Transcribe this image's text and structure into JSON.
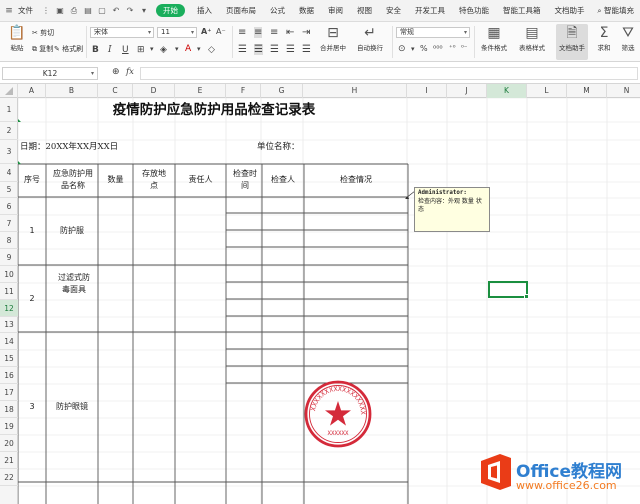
{
  "menubar": {
    "file_label": "文件",
    "tabs": [
      "开始",
      "插入",
      "页面布局",
      "公式",
      "数据",
      "审阅",
      "视图",
      "安全",
      "开发工具",
      "特色功能",
      "智能工具箱",
      "文档助手"
    ],
    "search_label": "智能填充"
  },
  "ribbon": {
    "paste_label": "粘贴",
    "cut_label": "剪切",
    "copy_label": "复制",
    "format_painter_label": "格式刷",
    "font_name": "宋体",
    "font_size": "11",
    "merge_center_label": "合并居中",
    "wrap_text_label": "自动换行",
    "number_format": "常规",
    "conditional_format_label": "条件格式",
    "table_style_label": "表格样式",
    "doc_assistant_label": "文档助手",
    "sum_label": "求和",
    "filter_label": "筛选"
  },
  "formula_bar": {
    "name_box": "K12",
    "fx_label": "fx",
    "content": ""
  },
  "columns": [
    {
      "label": "A",
      "width": 28
    },
    {
      "label": "B",
      "width": 52
    },
    {
      "label": "C",
      "width": 35
    },
    {
      "label": "D",
      "width": 42
    },
    {
      "label": "E",
      "width": 51
    },
    {
      "label": "F",
      "width": 35
    },
    {
      "label": "G",
      "width": 42
    },
    {
      "label": "H",
      "width": 104
    },
    {
      "label": "I",
      "width": 40
    },
    {
      "label": "J",
      "width": 40
    },
    {
      "label": "K",
      "width": 40
    },
    {
      "label": "L",
      "width": 40
    },
    {
      "label": "M",
      "width": 40
    },
    {
      "label": "N",
      "width": 40
    }
  ],
  "active_column": "K",
  "active_row": "12",
  "rows": [
    "1",
    "2",
    "3",
    "4",
    "5",
    "6",
    "7",
    "8",
    "9",
    "10",
    "11",
    "12",
    "13",
    "14",
    "15",
    "16",
    "17",
    "18",
    "19",
    "20",
    "21",
    "22"
  ],
  "sheet": {
    "title": "疫情防护应急防护用品检查记录表",
    "date_label": "日期：20XX年XX月XX日",
    "unit_label": "单位名称：",
    "headers": {
      "seq": "序号",
      "item": "应急防护用品名称",
      "qty": "数量",
      "location": "存放地点",
      "owner": "责任人",
      "check_time": "检查时间",
      "inspector": "检查人",
      "status": "检查情况"
    },
    "items": [
      {
        "seq": "1",
        "name": "防护服"
      },
      {
        "seq": "2",
        "name": "过滤式防毒面具"
      },
      {
        "seq": "3",
        "name": "防护眼镜"
      }
    ]
  },
  "comment": {
    "author": "Administrator:",
    "text": "检查内容：外观 数量 状态"
  },
  "stamp": {
    "ring_text": "XXXXXXXXXXXXXXXXXXXX",
    "bottom_text": "XXXXXX",
    "color": "#d42a3a"
  },
  "watermark": {
    "brand": "Office教程网",
    "url": "www.office26.com"
  },
  "colors": {
    "accent": "#1aae5c",
    "grid": "#e3e3e3",
    "table_border": "#555555"
  }
}
